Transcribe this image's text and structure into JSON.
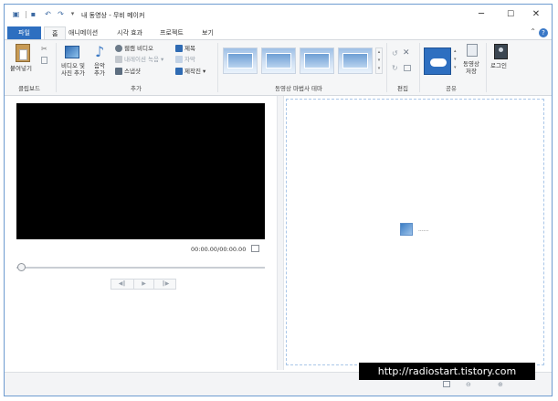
{
  "window": {
    "title": "내 동영상 - 무비 메이커",
    "minimize": "─",
    "maximize": "☐",
    "close": "✕"
  },
  "tabs": {
    "file": "파일",
    "items": [
      "홈",
      "애니메이션",
      "시각 효과",
      "프로젝트",
      "보기"
    ],
    "active": "홈"
  },
  "ribbon": {
    "clipboard": {
      "paste": "붙여넣기",
      "label": "클립보드"
    },
    "add": {
      "add_videos": "비디오 및 사진 추가",
      "add_music": "음악 추가",
      "webcam": "웹캠 비디오",
      "narration": "내레이션 녹음",
      "snapshot": "스냅샷",
      "title": "제목",
      "caption": "자막",
      "credits": "제작진",
      "label": "추가"
    },
    "themes": {
      "label": "동영상 마법사 테마"
    },
    "edit": {
      "label": "편집"
    },
    "share": {
      "save_movie": "동영상 저장",
      "label": "공유"
    },
    "signin": {
      "label": "로그인"
    }
  },
  "preview": {
    "timecode": "00:00.00/00:00.00"
  },
  "storyboard": {
    "placeholder": "......"
  },
  "watermark": "http://radiostart.tistory.com",
  "colors": {
    "accent": "#2e6fc0",
    "border": "#6d9bd0",
    "preview_bg": "#000000"
  }
}
